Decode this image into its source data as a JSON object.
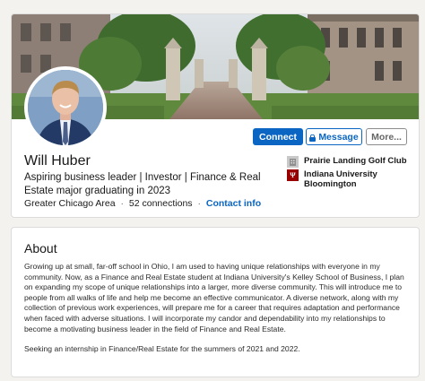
{
  "profile": {
    "name": "Will Huber",
    "headline": "Aspiring business leader | Investor | Finance & Real Estate major graduating in 2023",
    "location": "Greater Chicago Area",
    "connections": "52 connections",
    "contact_label": "Contact info",
    "separator": "·"
  },
  "actions": {
    "connect_label": "Connect",
    "message_label": "Message",
    "more_label": "More..."
  },
  "highlights": {
    "experience": {
      "name": "Prairie Landing Golf Club",
      "icon": "building-icon"
    },
    "education": {
      "name": "Indiana University Bloomington",
      "logo_letter": "Ψ",
      "icon": "iu-logo"
    }
  },
  "about": {
    "title": "About",
    "paragraphs": [
      "Growing up at small, far-off school in Ohio, I am used to having unique relationships with everyone in my community. Now, as a Finance and Real Estate student at Indiana University's Kelley School of Business, I plan on expanding my scope of unique relationships into a larger, more diverse community. This will introduce me to people from all walks of life and help me become an effective communicator. A diverse network, along with my collection of previous work experiences, will prepare me for a career that requires adaptation and performance when faced with adverse situations. I will incorporate my candor and dependability into my relationships to become a motivating business leader in the field of Finance and Real Estate.",
      "Seeking an internship in Finance/Real Estate for the summers of 2021 and 2022."
    ]
  },
  "colors": {
    "brand_blue": "#0a66c2",
    "iu_crimson": "#990000",
    "page_bg": "#f3f2ef"
  }
}
